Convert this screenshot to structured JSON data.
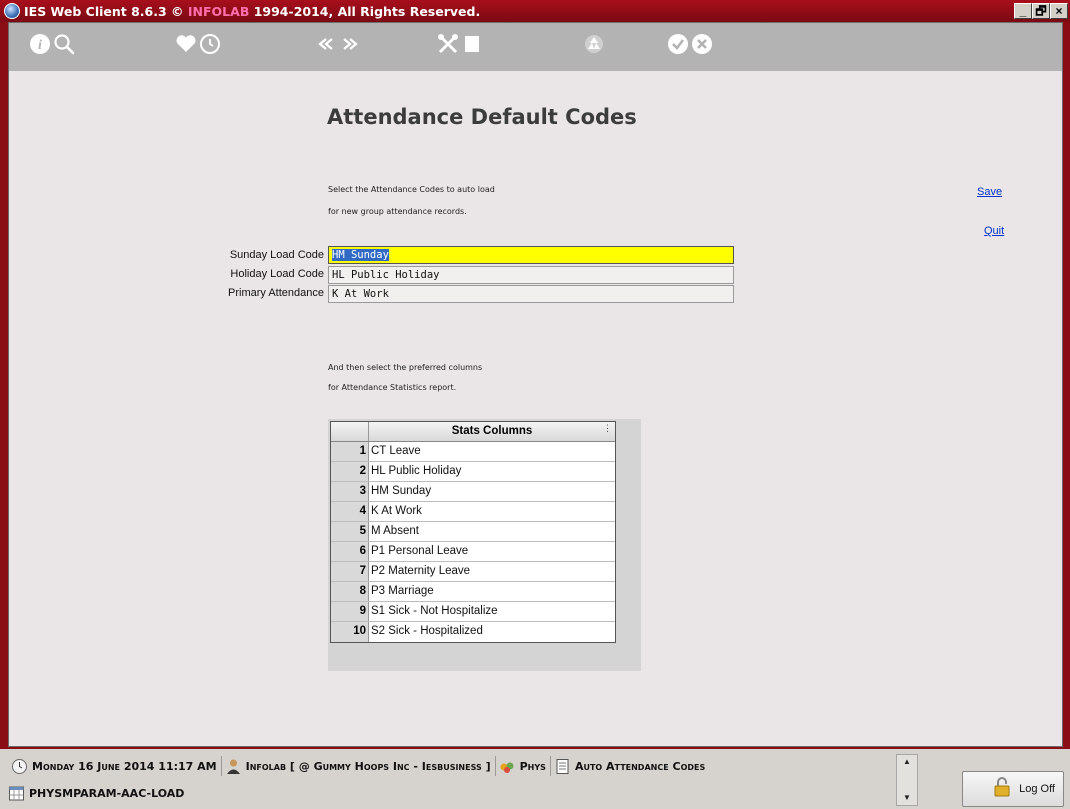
{
  "window": {
    "title_prefix": "IES Web Client 8.6.3 © ",
    "title_brand": "INFOLAB",
    "title_suffix": " 1994-2014, All Rights Reserved.",
    "controls": [
      "_",
      "🗗",
      "×"
    ]
  },
  "toolbar": {
    "icons": [
      "info-icon",
      "search-icon",
      "heart-icon",
      "history-icon",
      "previous-icon",
      "next-icon",
      "tools-icon",
      "blank-page-icon",
      "recycle-icon",
      "accept-icon",
      "cancel-icon"
    ]
  },
  "page": {
    "title": "Attendance Default Codes",
    "instructions_1": [
      "Select the Attendance Codes to auto load",
      "for new group attendance records."
    ],
    "instructions_2": [
      "And then select the preferred columns",
      "for Attendance Statistics report."
    ],
    "save_label": "Save",
    "quit_label": "Quit"
  },
  "form": {
    "sunday": {
      "label": "Sunday Load Code",
      "value": "HM Sunday"
    },
    "holiday": {
      "label": "Holiday Load Code",
      "value": "HL Public Holiday"
    },
    "primary": {
      "label": "Primary Attendance",
      "value": "K At Work"
    }
  },
  "stats_grid": {
    "header": "Stats Columns",
    "rows": [
      {
        "num": "1",
        "value": "CT Leave"
      },
      {
        "num": "2",
        "value": "HL Public Holiday"
      },
      {
        "num": "3",
        "value": "HM Sunday"
      },
      {
        "num": "4",
        "value": "K At Work"
      },
      {
        "num": "5",
        "value": "M Absent"
      },
      {
        "num": "6",
        "value": "P1 Personal Leave"
      },
      {
        "num": "7",
        "value": "P2 Maternity Leave"
      },
      {
        "num": "8",
        "value": "P3 Marriage"
      },
      {
        "num": "9",
        "value": "S1 Sick - Not Hospitalize"
      },
      {
        "num": "10",
        "value": "S2 Sick - Hospitalized"
      }
    ]
  },
  "statusbar": {
    "datetime": "Monday 16 June 2014 11:17 AM",
    "user": "Infolab [ @ Gummy Hoops Inc - Iesbusiness ]",
    "module": "Phys",
    "screen": "Auto Attendance Codes",
    "program": "PHYSMPARAM-AAC-LOAD",
    "logoff_label": "Log Off"
  },
  "colors": {
    "frame": "#8a0d16",
    "content_bg": "#eae6e7",
    "toolbar_bg": "#b3b3b3",
    "active_field": "#ffff00",
    "link": "#0033cc"
  }
}
